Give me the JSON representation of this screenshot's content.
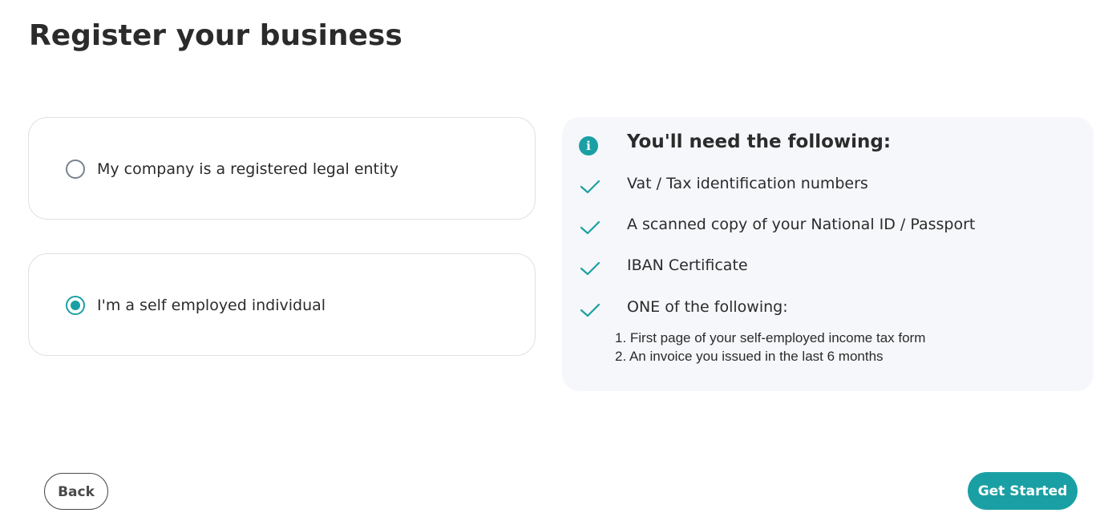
{
  "page": {
    "title": "Register your business"
  },
  "options": [
    {
      "label": "My company is a registered legal entity",
      "selected": false
    },
    {
      "label": "I'm a self employed individual",
      "selected": true
    }
  ],
  "requirements": {
    "icon": "info-icon",
    "heading": "You'll need the following:",
    "items": [
      {
        "label": "Vat / Tax identification numbers",
        "icon": "check-icon"
      },
      {
        "label": "A scanned copy of your National ID / Passport",
        "icon": "check-icon"
      },
      {
        "label": "IBAN Certificate",
        "icon": "check-icon"
      },
      {
        "label": "ONE of the following:",
        "icon": "check-icon"
      }
    ],
    "sub_items": [
      "1. First page of your self-employed income tax form",
      "2. An invoice you issued in the last 6 months"
    ]
  },
  "actions": {
    "back_label": "Back",
    "start_label": "Get Started"
  },
  "colors": {
    "accent": "#1aa0a4",
    "panel_bg": "#f6f7fa",
    "text": "#2b2b2b"
  }
}
